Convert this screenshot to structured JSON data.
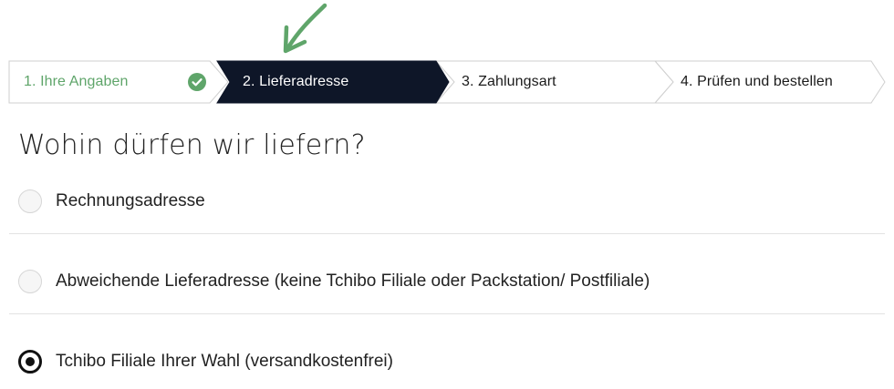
{
  "stepper": {
    "steps": [
      {
        "label": "1. Ihre Angaben",
        "state": "completed",
        "icon": "check-circle-icon"
      },
      {
        "label": "2. Lieferadresse",
        "state": "active"
      },
      {
        "label": "3. Zahlungsart",
        "state": "upcoming"
      },
      {
        "label": "4. Prüfen und bestellen",
        "state": "upcoming"
      }
    ]
  },
  "annotation": {
    "icon": "hand-drawn-arrow-icon",
    "color": "#5fa56a"
  },
  "delivery": {
    "heading": "Wohin dürfen wir liefern?",
    "options": [
      {
        "label": "Rechnungsadresse",
        "selected": false
      },
      {
        "label": "Abweichende Lieferadresse (keine Tchibo Filiale oder Packstation/ Postfiliale)",
        "selected": false
      },
      {
        "label": "Tchibo Filiale Ihrer Wahl (versandkostenfrei)",
        "selected": true
      }
    ]
  },
  "colors": {
    "active_step_bg": "#0e1628",
    "completed_green": "#5fa56a",
    "border": "#cfcfcf"
  }
}
